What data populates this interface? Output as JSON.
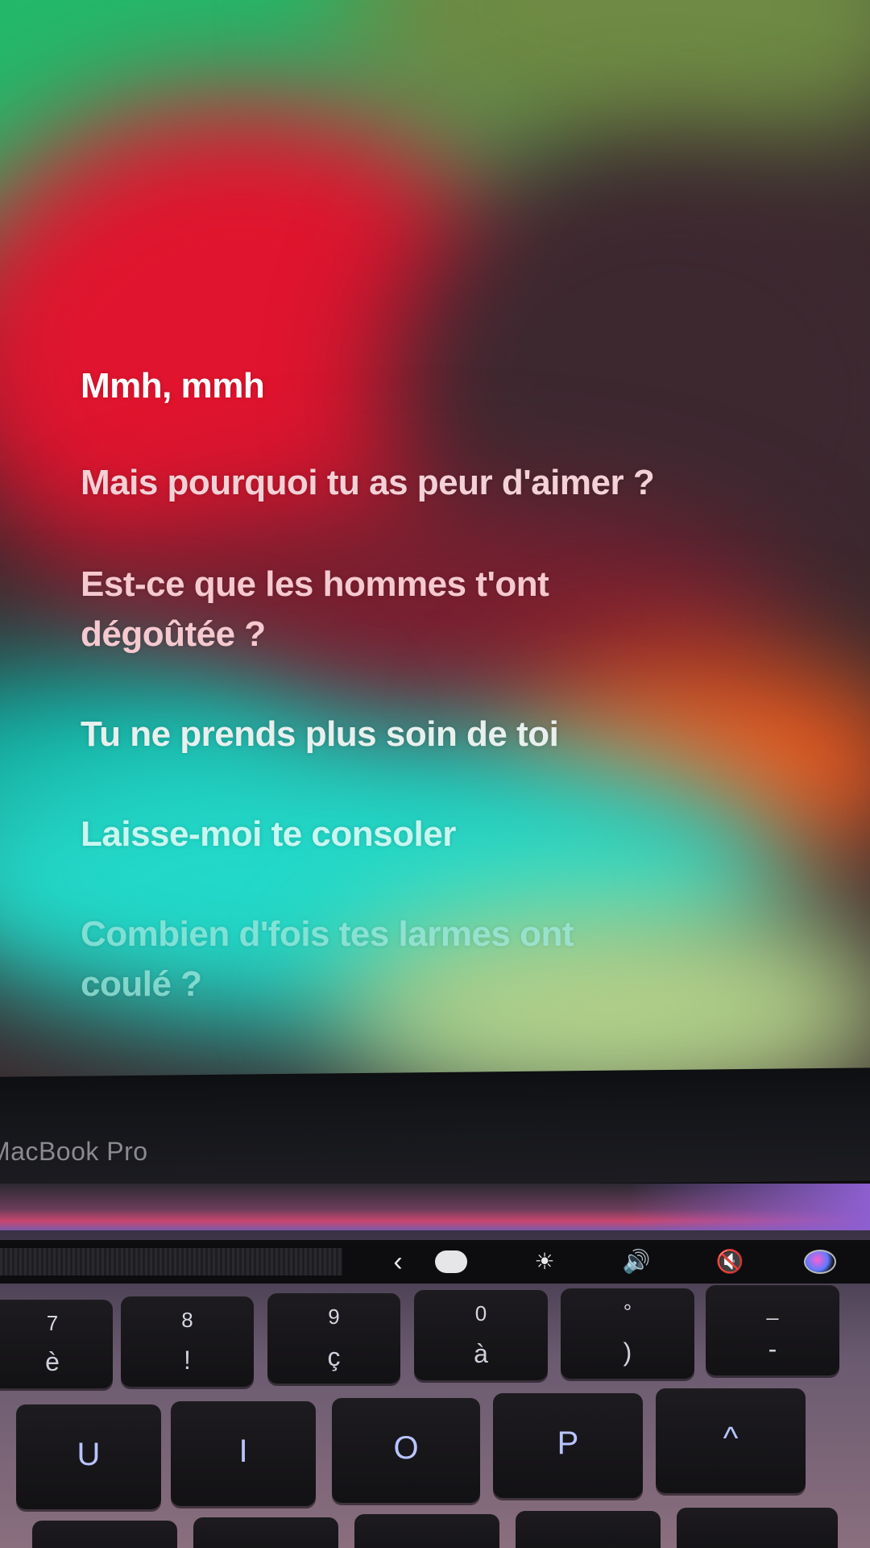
{
  "lyrics": [
    "Mmh, mmh",
    "Mais pourquoi tu as peur d'aimer ?",
    "Est-ce que les hommes t'ont dégoûtée ?",
    "Tu ne prends plus soin de toi",
    "Laisse-moi te consoler",
    "Combien d'fois tes larmes ont coulé ?"
  ],
  "laptop": {
    "brand": "MacBook Pro"
  },
  "touchbar_icons": [
    "chevron-left-icon",
    "screen-record-icon",
    "brightness-icon",
    "volume-icon",
    "mute-icon",
    "siri-icon"
  ],
  "keys_row1": [
    {
      "top": "7",
      "bottom": "è"
    },
    {
      "top": "8",
      "bottom": "!"
    },
    {
      "top": "9",
      "bottom": "ç"
    },
    {
      "top": "0",
      "bottom": "à"
    },
    {
      "top": "°",
      "bottom": ")"
    },
    {
      "top": "_",
      "bottom": "-"
    }
  ],
  "keys_row2": [
    "U",
    "I",
    "O",
    "P",
    "^"
  ],
  "colors": {
    "screen_red": "#e0142e",
    "screen_green": "#23b86a",
    "screen_cyan": "#22d8c8",
    "screen_orange": "#f05a1e"
  }
}
